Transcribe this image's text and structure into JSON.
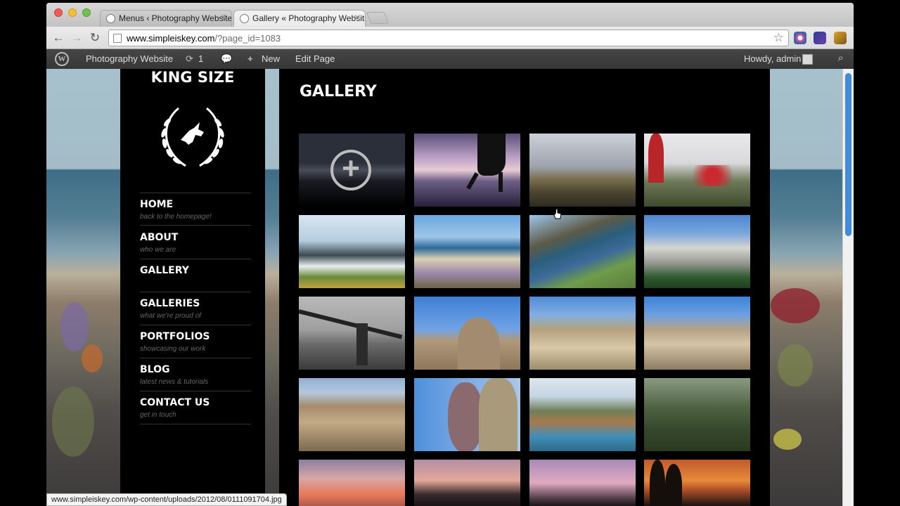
{
  "browser": {
    "tabs": [
      {
        "title": "Menus ‹ Photography Website",
        "active": false
      },
      {
        "title": "Gallery « Photography Website",
        "active": true
      }
    ],
    "url": "www.simpleiskey.com",
    "url_path": "/?page_id=1083",
    "status_text": "www.simpleiskey.com/wp-content/uploads/2012/08/0111091704.jpg"
  },
  "adminbar": {
    "site_name": "Photography Website",
    "updates_count": "1",
    "new_label": "New",
    "edit_label": "Edit Page",
    "howdy": "Howdy, admin"
  },
  "sidebar": {
    "brand": "KING SIZE",
    "menu": [
      {
        "title": "HOME",
        "subtitle": "back to the homepage!"
      },
      {
        "title": "ABOUT",
        "subtitle": "who we are"
      },
      {
        "title": "GALLERY",
        "subtitle": ""
      },
      {
        "title": "GALLERIES",
        "subtitle": "what we're proud of"
      },
      {
        "title": "PORTFOLIOS",
        "subtitle": "showcasing our work"
      },
      {
        "title": "BLOG",
        "subtitle": "latest news & tutorials"
      },
      {
        "title": "CONTACT US",
        "subtitle": "get in touch"
      }
    ]
  },
  "page": {
    "title": "GALLERY",
    "gallery": [
      {
        "name": "dusk-horizon",
        "hovered": true
      },
      {
        "name": "beach-silhouette",
        "hovered": false
      },
      {
        "name": "road-hills",
        "hovered": false
      },
      {
        "name": "red-aloe",
        "hovered": false
      },
      {
        "name": "coast-building",
        "hovered": false
      },
      {
        "name": "beach-flowers",
        "hovered": false
      },
      {
        "name": "green-cliff",
        "hovered": false
      },
      {
        "name": "granite-dome",
        "hovered": false
      },
      {
        "name": "brooklyn-bridge",
        "hovered": false
      },
      {
        "name": "boulder-climber",
        "hovered": false
      },
      {
        "name": "desert-trail",
        "hovered": false
      },
      {
        "name": "rock-pile",
        "hovered": false
      },
      {
        "name": "rocky-plain",
        "hovered": false
      },
      {
        "name": "tall-rocks",
        "hovered": false
      },
      {
        "name": "palm-hotel-pool",
        "hovered": false
      },
      {
        "name": "garden-trees",
        "hovered": false
      },
      {
        "name": "pink-sunset",
        "hovered": false
      },
      {
        "name": "palm-sunset",
        "hovered": false
      },
      {
        "name": "trees-sunset",
        "hovered": false
      },
      {
        "name": "orange-sunset",
        "hovered": false
      }
    ]
  },
  "colors": {
    "accent_scrollbar": "#3f8be0",
    "content_bg": "#000000",
    "adminbar_bg": "#3f3f3f"
  }
}
